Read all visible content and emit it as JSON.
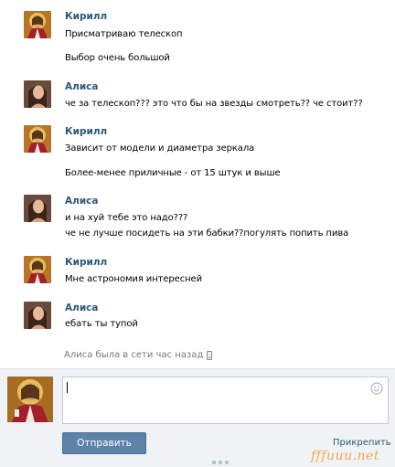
{
  "messages": [
    {
      "author": "Кирилл",
      "avatar": "jesus-icon",
      "lines": [
        "Присматриваю телескоп",
        "Выбор очень большой"
      ]
    },
    {
      "author": "Алиса",
      "avatar": "girl-icon",
      "lines": [
        "че за телескоп??? это что бы на звезды смотреть?? че стоит??"
      ]
    },
    {
      "author": "Кирилл",
      "avatar": "jesus-icon",
      "lines": [
        "Зависит от модели и диаметра зеркала",
        "Более-менее приличные - от 15 штук и выше"
      ]
    },
    {
      "author": "Алиса",
      "avatar": "girl-icon",
      "lines": [
        "и на хуй тебе это надо???",
        "че не лучше посидеть на эти бабки??погулять попить пива"
      ]
    },
    {
      "author": "Кирилл",
      "avatar": "jesus-icon",
      "lines": [
        "Мне астрономия интересней"
      ]
    },
    {
      "author": "Алиса",
      "avatar": "girl-icon",
      "lines": [
        "ебать ты тупой"
      ]
    }
  ],
  "status": {
    "text": "Алиса была в сети час назад",
    "icon": "mobile-phone-icon"
  },
  "compose": {
    "input_value": "",
    "smile_icon": "smile-icon",
    "send_label": "Отправить",
    "attach_label": "Прикрепить"
  },
  "watermark": "fffuuu.net",
  "colors": {
    "author": "#2b587a",
    "send_button": "#5e82a8",
    "panel": "#f0f3f6",
    "watermark": "#f3a84a"
  }
}
